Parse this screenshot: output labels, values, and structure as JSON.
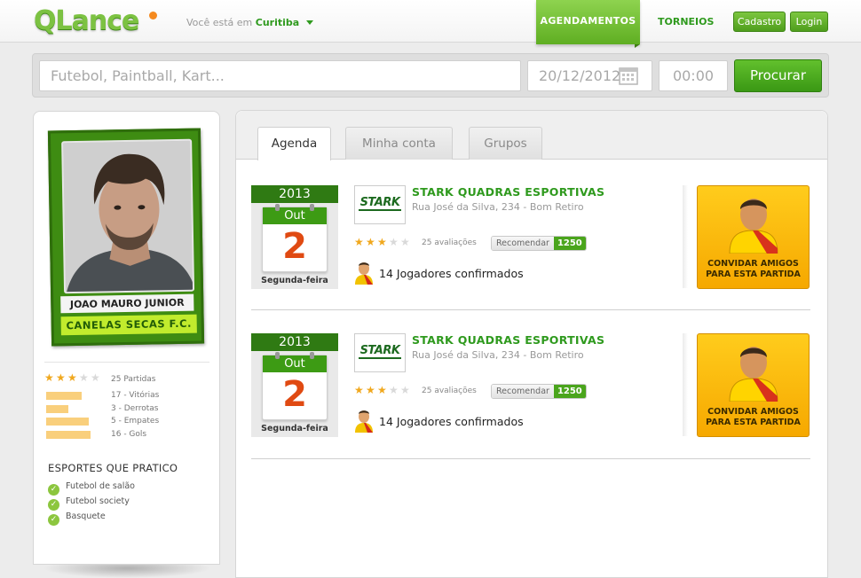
{
  "header": {
    "logo": "QLance",
    "location_prefix": "Você está em",
    "city": "Curitiba",
    "nav": [
      "AGENDAMENTOS",
      "TORNEIOS"
    ],
    "cadastro": "Cadastro",
    "login": "Login"
  },
  "search": {
    "query_placeholder": "Futebol, Paintball, Kart...",
    "date_value": "20/12/2012",
    "time_value": "00:00",
    "button": "Procurar"
  },
  "profile": {
    "player_name": "JOAO MAURO JUNIOR",
    "team_name": "CANELAS SECAS F.C.",
    "rating": 3,
    "rating_max": 5,
    "partidas": "25 Partidas",
    "stats": [
      {
        "label": "17 - Vitórias",
        "fraction": 0.6
      },
      {
        "label": "3 - Derrotas",
        "fraction": 0.38
      },
      {
        "label": "5 - Empates",
        "fraction": 0.73
      },
      {
        "label": "16 - Gols",
        "fraction": 0.75
      }
    ],
    "sports_title": "ESPORTES QUE PRATICO",
    "sports": [
      "Futebol de salão",
      "Futebol society",
      "Basquete"
    ]
  },
  "tabs": [
    "Agenda",
    "Minha conta",
    "Grupos"
  ],
  "events": [
    {
      "year": "2013",
      "month": "Out",
      "day": "2",
      "weekday": "Segunda-feira",
      "venue_logo": "STARK",
      "venue": "STARK QUADRAS ESPORTIVAS",
      "address": "Rua José da Silva, 234 - Bom Retiro",
      "rating": 3,
      "reviews": "25 avaliações",
      "recommend_label": "Recomendar",
      "recommend_count": "1250",
      "players": "14 Jogadores confirmados",
      "invite": "CONVIDAR AMIGOS PARA ESTA PARTIDA"
    },
    {
      "year": "2013",
      "month": "Out",
      "day": "2",
      "weekday": "Segunda-feira",
      "venue_logo": "STARK",
      "venue": "STARK QUADRAS ESPORTIVAS",
      "address": "Rua José da Silva, 234 - Bom Retiro",
      "rating": 3,
      "reviews": "25 avaliações",
      "recommend_label": "Recomendar",
      "recommend_count": "1250",
      "players": "14 Jogadores confirmados",
      "invite": "CONVIDAR AMIGOS PARA ESTA PARTIDA"
    }
  ],
  "colors": {
    "brand_green": "#2f9a1e",
    "accent_orange": "#f58a1f",
    "invite_yellow": "#ffcc1c"
  }
}
